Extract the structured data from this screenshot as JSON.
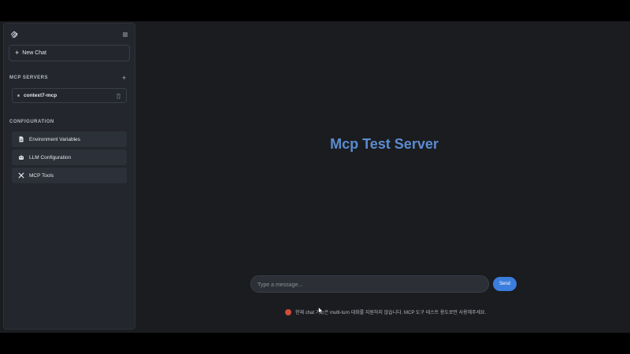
{
  "sidebar": {
    "new_chat_label": "New Chat",
    "mcp_servers_title": "MCP SERVERS",
    "servers": [
      {
        "name": "context7-mcp"
      }
    ],
    "configuration_title": "CONFIGURATION",
    "config_items": [
      {
        "label": "Environment Variables",
        "icon": "document-icon"
      },
      {
        "label": "LLM Configuration",
        "icon": "robot-icon"
      },
      {
        "label": "MCP Tools",
        "icon": "tools-icon"
      }
    ]
  },
  "main": {
    "title": "Mcp Test Server",
    "input_placeholder": "Type a message...",
    "send_label": "Send",
    "notice": "현재 chat 기능은 multi-turn 대화를 지원하지 않습니다. MCP 도구 테스트 용도로만 사용해주세요."
  },
  "colors": {
    "accent": "#3b7ddd",
    "title": "#5b8cd1",
    "sidebar_bg": "#23262d",
    "main_bg": "#1b1c1f",
    "notice_dot": "#d24b3a"
  }
}
